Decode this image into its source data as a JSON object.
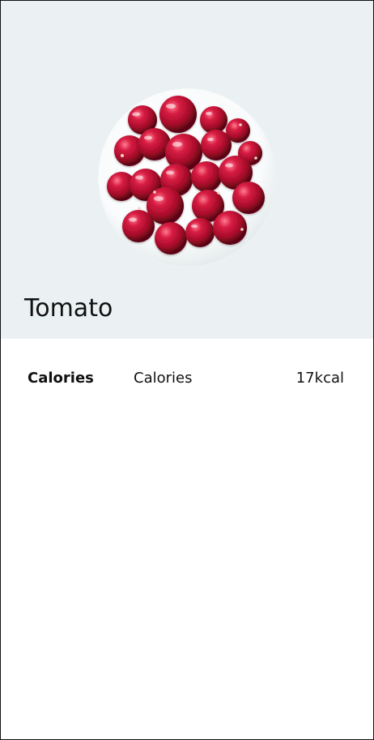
{
  "food": {
    "name": "Tomato",
    "image_subject": "bowl-of-red-berries"
  },
  "nutrition": {
    "heading": "Calories",
    "item_label": "Calories",
    "item_value": "17kcal"
  },
  "colors": {
    "hero_background": "#ebf1f2",
    "berry_red": "#b8102f",
    "bowl": "#ffffff"
  }
}
